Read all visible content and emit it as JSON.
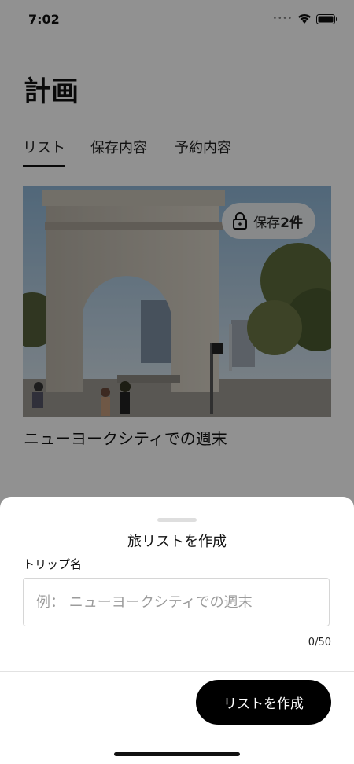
{
  "status_bar": {
    "time": "7:02"
  },
  "page": {
    "title": "計画",
    "tabs": [
      {
        "label": "リスト",
        "active": true
      },
      {
        "label": "保存内容",
        "active": false
      },
      {
        "label": "予約内容",
        "active": false
      }
    ]
  },
  "trip_card": {
    "saved_prefix": "保存",
    "saved_count": "2件",
    "title": "ニューヨークシティでの週末",
    "badge_icon": "lock-icon"
  },
  "sheet": {
    "title": "旅リストを作成",
    "field_label": "トリップ名",
    "input_value": "",
    "input_placeholder": "例： ニューヨークシティでの週末",
    "char_count": "0/50",
    "create_button_label": "リストを作成"
  },
  "colors": {
    "overlay": "#000000",
    "button_bg": "#000000",
    "button_text": "#ffffff",
    "tab_underline": "#111111"
  }
}
